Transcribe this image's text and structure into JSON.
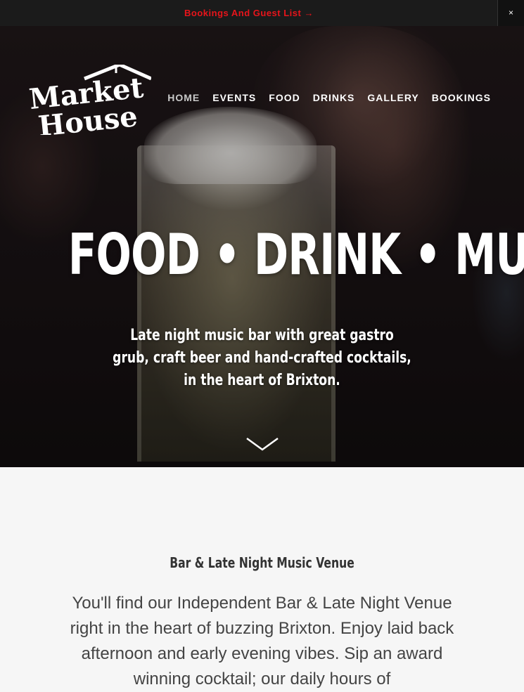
{
  "topbar": {
    "link_label": "Bookings And Guest List →",
    "close_label": "×"
  },
  "logo": {
    "line1": "Market",
    "line2": "House"
  },
  "nav": {
    "items": [
      "HOME",
      "EVENTS",
      "FOOD",
      "DRINKS",
      "GALLERY",
      "BOOKINGS"
    ],
    "active": "HOME"
  },
  "hero": {
    "title": "FOOD • DRINK • MUSIC",
    "subtitle": "Late night music bar with great gastro grub, craft beer and hand-crafted cocktails, in the heart of Brixton.",
    "scroll_icon": "chevron-down-icon"
  },
  "intro": {
    "title": "Bar & Late Night Music Venue",
    "body": "You'll find our Independent Bar & Late Night Venue right in the heart of buzzing Brixton. Enjoy laid back afternoon and early evening vibes. Sip an award winning cocktail; our daily hours of"
  },
  "colors": {
    "accent_red": "#e8141b",
    "topbar_bg": "#1b1b1b",
    "page_bg": "#f6f6f6"
  }
}
